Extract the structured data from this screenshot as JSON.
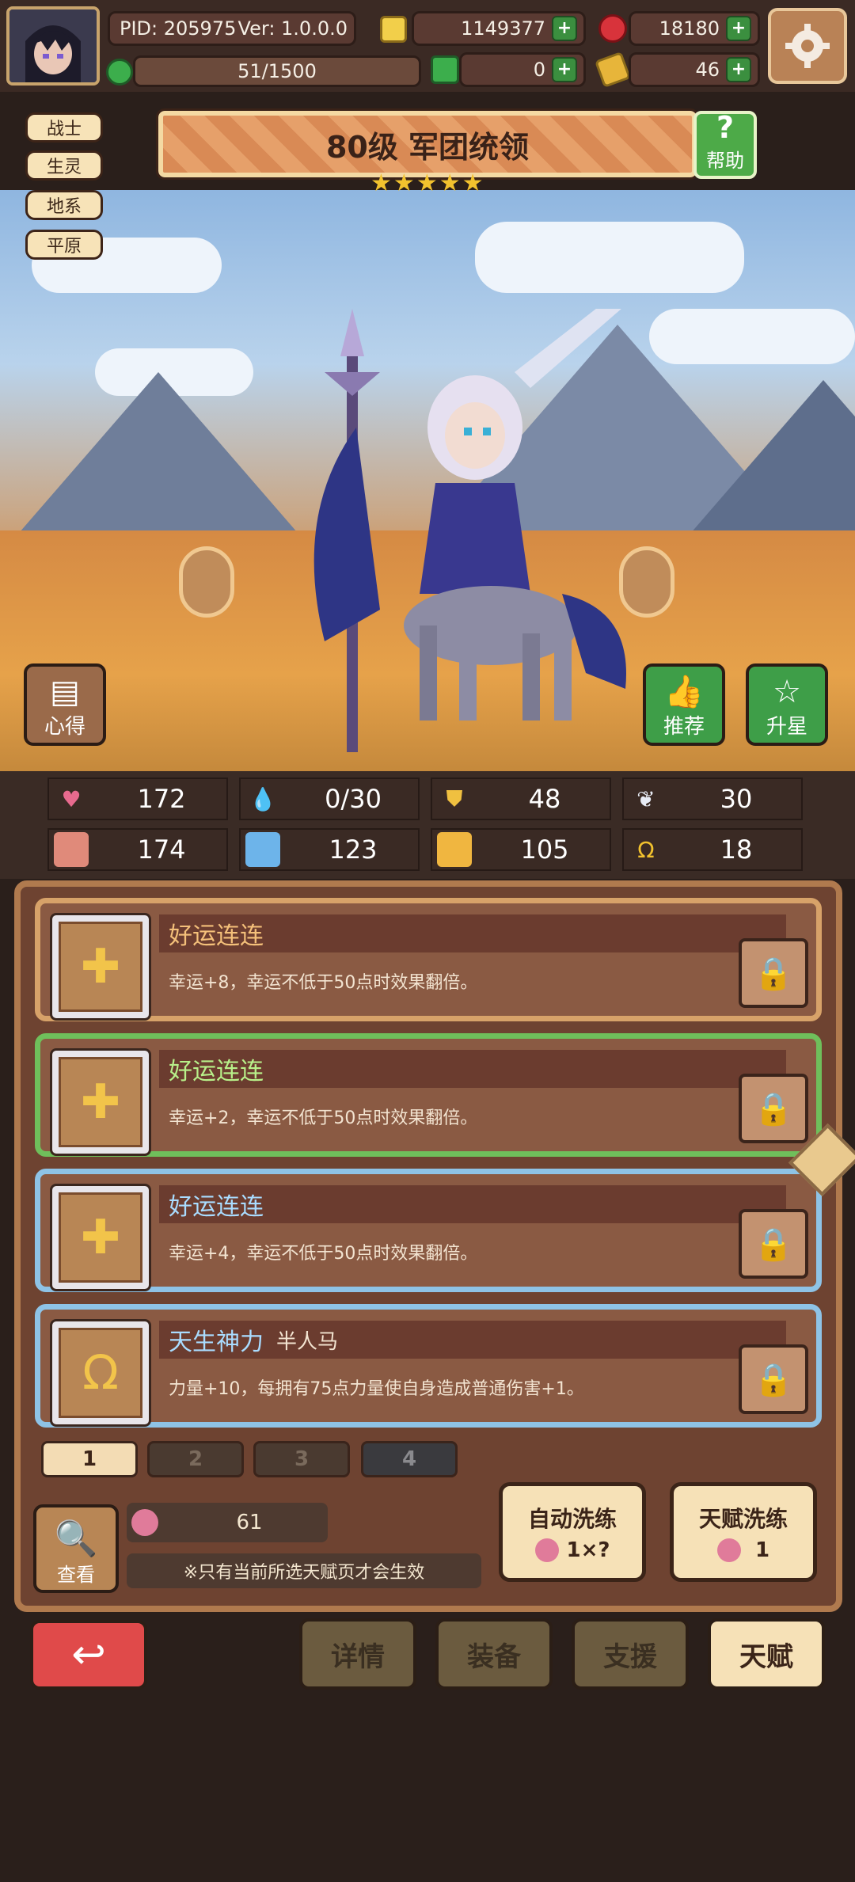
{
  "header": {
    "pid_text": "PID: 205975",
    "version_text": "Ver: 1.0.0.0",
    "gold": "1149377",
    "gems": "18180",
    "energy": "51/1500",
    "clover": "0",
    "tickets": "46"
  },
  "tags": [
    "战士",
    "生灵",
    "地系",
    "平原"
  ],
  "hero": {
    "title": "80级 军团统领",
    "stars": 5,
    "help_label": "帮助",
    "tips_label": "心得",
    "recommend_label": "推荐",
    "starup_label": "升星"
  },
  "stats": [
    {
      "icon": "heart-icon",
      "value": "172"
    },
    {
      "icon": "water-drop-icon",
      "value": "0/30"
    },
    {
      "icon": "shield-icon",
      "value": "48"
    },
    {
      "icon": "wing-icon",
      "value": "30"
    },
    {
      "icon": "fist-icon",
      "value": "174"
    },
    {
      "icon": "book-icon",
      "value": "123"
    },
    {
      "icon": "boot-icon",
      "value": "105"
    },
    {
      "icon": "horseshoe-icon",
      "value": "18"
    }
  ],
  "talents": [
    {
      "title": "好运连连",
      "subtitle": "",
      "desc": "幸运+8，幸运不低于50点时效果翻倍。",
      "border": "#d7a269",
      "title_color": "#f4c07a",
      "icon": "clover-cross-icon"
    },
    {
      "title": "好运连连",
      "subtitle": "",
      "desc": "幸运+2，幸运不低于50点时效果翻倍。",
      "border": "#6fbf5b",
      "title_color": "#b8f08a",
      "icon": "clover-cross-icon"
    },
    {
      "title": "好运连连",
      "subtitle": "",
      "desc": "幸运+4，幸运不低于50点时效果翻倍。",
      "border": "#8ec3e6",
      "title_color": "#a9dcff",
      "icon": "clover-cross-icon"
    },
    {
      "title": "天生神力",
      "subtitle": "半人马",
      "desc": "力量+10，每拥有75点力量使自身造成普通伤害+1。",
      "border": "#8ec3e6",
      "title_color": "#a9dcff",
      "icon": "horseshoe-icon"
    }
  ],
  "pages": [
    "1",
    "2",
    "3",
    "4"
  ],
  "bottom": {
    "view_label": "查看",
    "potion_count": "61",
    "notice": "※只有当前所选天赋页才会生效",
    "auto_reroll_label": "自动洗练",
    "auto_reroll_cost": "1×?",
    "reroll_label": "天赋洗练",
    "reroll_cost": "1"
  },
  "nav": {
    "details": "详情",
    "equipment": "装备",
    "support": "支援",
    "talent": "天赋"
  }
}
